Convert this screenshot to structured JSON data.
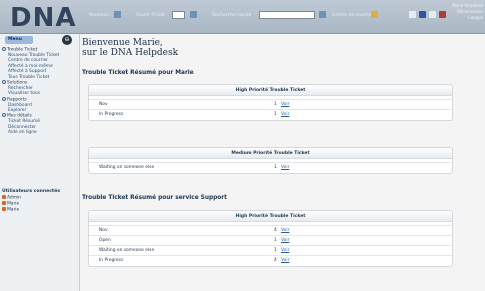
{
  "header": {
    "logo": "DNA",
    "nouveau_label": "Nouveau :",
    "ouvrir_label": "Ouvrir Ticket",
    "recherche_label": "Recherche rapide",
    "centre_label": "Centre de courrier",
    "user_lines": [
      "Marie Helpdesk",
      "Déconnexion",
      "Langue"
    ]
  },
  "sidebar": {
    "menu_label": "Menu",
    "toggle_symbol": "⊖",
    "items": [
      {
        "label": "Trouble Ticket",
        "type": "cat"
      },
      {
        "label": "Nouveau Trouble Ticket",
        "type": "sub"
      },
      {
        "label": "Centre de courrier",
        "type": "sub"
      },
      {
        "label": "Affecté à moi-même",
        "type": "sub"
      },
      {
        "label": "Affecté à Support",
        "type": "sub"
      },
      {
        "label": "Tous Trouble Ticket",
        "type": "sub"
      },
      {
        "label": "Solutions",
        "type": "cat"
      },
      {
        "label": "Rechercher",
        "type": "sub"
      },
      {
        "label": "Visualiser tous",
        "type": "sub"
      },
      {
        "label": "Rapports",
        "type": "cat"
      },
      {
        "label": "Dashboard",
        "type": "sub"
      },
      {
        "label": "Explorer",
        "type": "sub"
      },
      {
        "label": "Mes détails",
        "type": "cat"
      },
      {
        "label": "Ticket Résumé",
        "type": "sub"
      },
      {
        "label": "Déconnecter",
        "type": "sub"
      },
      {
        "label": "Aide en ligne",
        "type": "sub"
      }
    ],
    "connected_title": "Utilisateurs connectés",
    "connected": [
      "Admin",
      "Marie",
      "Marie"
    ]
  },
  "main": {
    "welcome_line1": "Bienvenue Marie,",
    "welcome_line2": "sur le DNA Helpdesk",
    "section1_title": "Trouble Ticket Résumé pour Marie",
    "panel_high1": {
      "head": "High Priorité Trouble Ticket",
      "rows": [
        {
          "status": "Nov",
          "count": "1",
          "link": "Voir"
        },
        {
          "status": "In Progress",
          "count": "1",
          "link": "Voir"
        }
      ]
    },
    "panel_medium1": {
      "head": "Medium Priorité Trouble Ticket",
      "rows": [
        {
          "status": "Waiting on someone else",
          "count": "1",
          "link": "Voir"
        }
      ]
    },
    "section2_title": "Trouble Ticket Résumé pour service Support",
    "panel_high2": {
      "head": "High Priorité Trouble Ticket",
      "rows": [
        {
          "status": "Nov",
          "count": "4",
          "link": "Voir"
        },
        {
          "status": "Open",
          "count": "1",
          "link": "Voir"
        },
        {
          "status": "Waiting on someone else",
          "count": "1",
          "link": "Voir"
        },
        {
          "status": "In Progress",
          "count": "4",
          "link": "Voir"
        }
      ]
    }
  },
  "colors": {
    "topbar": "#aab6c3",
    "link": "#2b5ea8",
    "text": "#1d3550",
    "menu_tab": "#9db8dd"
  }
}
